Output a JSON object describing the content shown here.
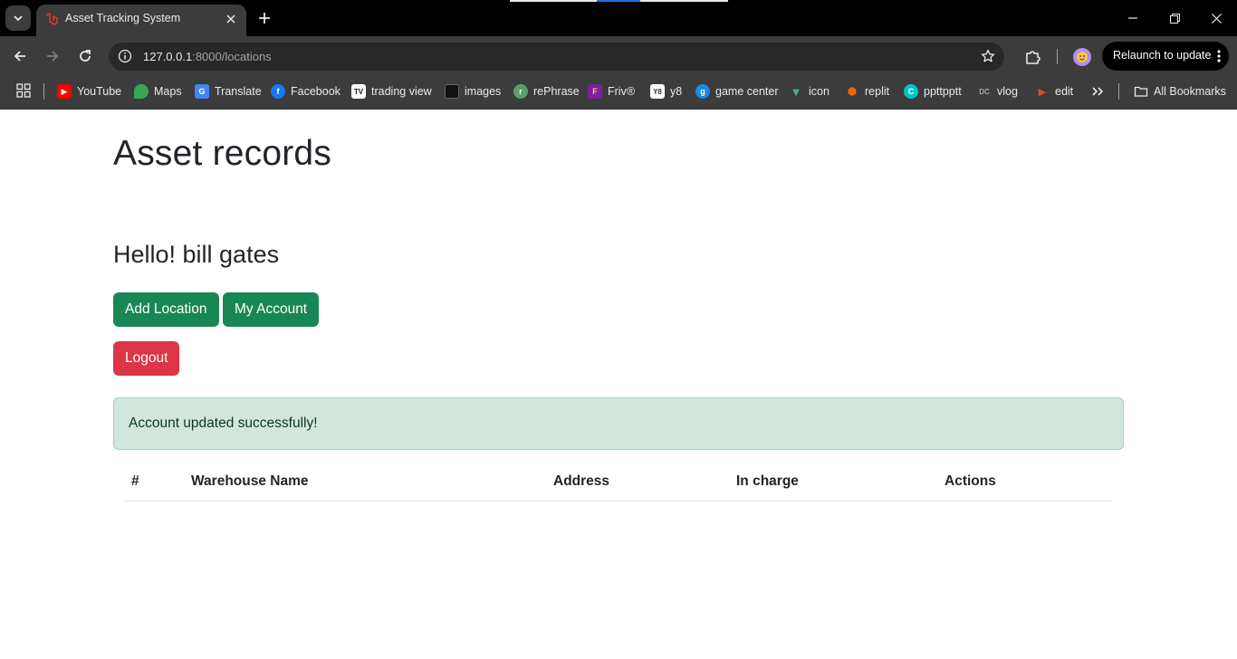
{
  "browser": {
    "tab_title": "Asset Tracking System",
    "url_host": "127.0.0.1",
    "url_path": ":8000/locations",
    "relaunch_label": "Relaunch to update",
    "bookmarks": [
      {
        "label": "YouTube",
        "icon": "youtube-icon",
        "color": "#ff0000"
      },
      {
        "label": "Maps",
        "icon": "maps-pin-icon",
        "color": "#34a853"
      },
      {
        "label": "Translate",
        "icon": "translate-icon",
        "color": "#4285f4"
      },
      {
        "label": "Facebook",
        "icon": "facebook-icon",
        "color": "#1877f2"
      },
      {
        "label": "trading view",
        "icon": "tradingview-icon",
        "color": "#131722"
      },
      {
        "label": "images",
        "icon": "images-icon",
        "color": "#111111"
      },
      {
        "label": "rePhrase",
        "icon": "rephrase-icon",
        "color": "#5a9e6f"
      },
      {
        "label": "Friv®",
        "icon": "friv-icon",
        "color": "#7b1fa2"
      },
      {
        "label": "y8",
        "icon": "y8-icon",
        "color": "#333333"
      },
      {
        "label": "game center",
        "icon": "game-center-icon",
        "color": "#1e88e5"
      },
      {
        "label": "icon",
        "icon": "vue-icon",
        "color": "#42b883"
      },
      {
        "label": "replit",
        "icon": "replit-icon",
        "color": "#f26207"
      },
      {
        "label": "ppttpptt",
        "icon": "canva-icon",
        "color": "#00c4cc"
      },
      {
        "label": "vlog",
        "icon": "vlog-icon",
        "color": "#333333"
      },
      {
        "label": "edit",
        "icon": "edit-play-icon",
        "color": "#ea4335"
      }
    ],
    "all_bookmarks_label": "All Bookmarks"
  },
  "page": {
    "title": "Asset records",
    "greeting": "Hello! bill gates",
    "buttons": {
      "add_location": "Add Location",
      "my_account": "My Account",
      "logout": "Logout"
    },
    "alert": "Account updated successfully!",
    "table": {
      "columns": [
        "#",
        "Warehouse Name",
        "Address",
        "In charge",
        "Actions"
      ]
    }
  }
}
